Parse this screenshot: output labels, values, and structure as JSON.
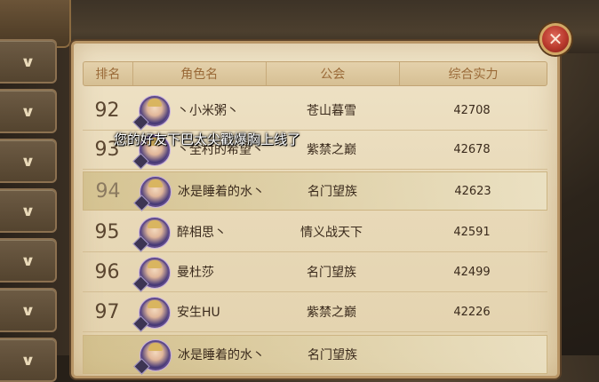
{
  "columns": {
    "rank": "排名",
    "name": "角色名",
    "guild": "公会",
    "power": "综合实力"
  },
  "rows": [
    {
      "rank": "92",
      "name": "丶小米粥丶",
      "guild": "苍山暮雪",
      "power": "42708",
      "highlight": false
    },
    {
      "rank": "93",
      "name": "丶全村的希望丶",
      "guild": "紫禁之巅",
      "power": "42678",
      "highlight": false
    },
    {
      "rank": "94",
      "name": "冰是睡着的水丶",
      "guild": "名门望族",
      "power": "42623",
      "highlight": true
    },
    {
      "rank": "95",
      "name": "醉相思丶",
      "guild": "情义战天下",
      "power": "42591",
      "highlight": false
    },
    {
      "rank": "96",
      "name": "曼杜莎",
      "guild": "名门望族",
      "power": "42499",
      "highlight": false
    },
    {
      "rank": "97",
      "name": "安生HU",
      "guild": "紫禁之巅",
      "power": "42226",
      "highlight": false
    },
    {
      "rank": "",
      "name": "冰是睡着的水丶",
      "guild": "名门望族",
      "power": "",
      "highlight": true
    }
  ],
  "toast": "您的好友下巴太尖戳爆胸上线了",
  "side_buttons": [
    "∨",
    "∨",
    "∨",
    "∨",
    "∨",
    "∨",
    "∨"
  ],
  "close_glyph": "✕",
  "colors": {
    "panel": "#efe3c7",
    "header_text": "#9a6a38",
    "close_red": "#b8392c"
  }
}
